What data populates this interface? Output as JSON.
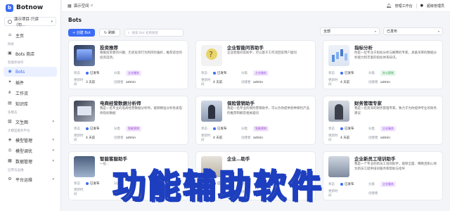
{
  "brand": {
    "name": "Botnow"
  },
  "project": {
    "label": "演示项目-只读（勿…"
  },
  "sidebar": {
    "items": [
      {
        "label": "主页",
        "icon": "home-icon"
      },
      {
        "section": "探索"
      },
      {
        "label": "Bots 商店",
        "icon": "store-icon"
      },
      {
        "section": "智能体协作"
      },
      {
        "label": "Bots",
        "icon": "bot-icon",
        "active": true
      },
      {
        "label": "插件",
        "icon": "plugin-icon"
      },
      {
        "label": "工作流",
        "icon": "workflow-icon"
      },
      {
        "label": "知识库",
        "icon": "knowledge-icon"
      },
      {
        "section": "多模态"
      },
      {
        "label": "文生图",
        "icon": "image-icon",
        "expandable": true
      },
      {
        "section": "大模型服务平台"
      },
      {
        "label": "模型管理",
        "icon": "model-icon",
        "expandable": true
      },
      {
        "label": "模型调优",
        "icon": "tuning-icon",
        "expandable": true
      },
      {
        "label": "数据管理",
        "icon": "data-icon",
        "expandable": true
      },
      {
        "section": "应用与运维"
      },
      {
        "label": "平台运维",
        "icon": "ops-icon",
        "expandable": true
      }
    ]
  },
  "topbar": {
    "workspace": "演示空间",
    "workbench": "管理工作台",
    "user": "超级管理员"
  },
  "main": {
    "title": "Bots",
    "create_label": "+ 创建 Bot",
    "refresh_label": "刷新",
    "search_placeholder": "搜索 Bot 名称搜索",
    "filter_all": "全部",
    "filter_status": "已发布"
  },
  "card_labels": {
    "status": "状态",
    "category": "分类",
    "updated": "更新时间",
    "creator": "创建者"
  },
  "cards": [
    {
      "title": "投资推荐",
      "desc": "根据投资者的兴趣、历史投资行为和风险偏好，推荐适合的投资选项。",
      "status": "已发布",
      "category": "企业服务",
      "updated": "3 天前",
      "creator": "admin",
      "tag_style": "purple"
    },
    {
      "title": "企业智能问答助手",
      "desc": "企业智能问答助手，可以基于工作流回答用户疑问",
      "status": "已发布",
      "category": "企业服务",
      "updated": "4 天前",
      "creator": "admin",
      "tag_style": "purple"
    },
    {
      "title": "指标分析",
      "desc": "你是一位专注于指标分析与解释的专家，具备深厚的数据分析能力和丰富的指标体系知识。",
      "status": "已发布",
      "category": "办公提效",
      "updated": "4 天前",
      "creator": "admin",
      "tag_style": "green"
    },
    {
      "title": "电商经营数据分析师",
      "desc": "我是一名专业的电商经营数据分析师，能够精准分析各类电商指标数据",
      "status": "已发布",
      "category": "智能营销",
      "updated": "4 天前",
      "creator": "admin",
      "tag_style": "purple2"
    },
    {
      "title": "保险营销助手",
      "desc": "我是一名专业的保险营销助手，可以为你提供各种保险产品的推荐和解答相关疑问",
      "status": "已发布",
      "category": "智能营销",
      "updated": "4 天前",
      "creator": "admin",
      "tag_style": "purple2"
    },
    {
      "title": "财务管理专家",
      "desc": "我是一名资深的财务管理专家，致力于为你提供专业的财务建议",
      "status": "已发布",
      "category": "企业服务",
      "updated": "4 天前",
      "creator": "admin",
      "tag_style": "purple"
    },
    {
      "title": "智能客服助手",
      "desc": "一位…",
      "status": "已发布",
      "category": "",
      "updated": "",
      "creator": "",
      "tag_style": "purple"
    },
    {
      "title": "企业…助手",
      "desc": "",
      "status": "已发布",
      "category": "",
      "updated": "",
      "creator": "",
      "tag_style": "purple"
    },
    {
      "title": "企业新员工培训助手",
      "desc": "我是一个专业的新员工培训助手，能够全面、细致且耐心地为新员工提供培训服务和帮助与指导",
      "status": "已发布",
      "category": "企业服务",
      "updated": "",
      "creator": "",
      "tag_style": "purple"
    }
  ],
  "overlay": {
    "text": "功能辅助软件"
  }
}
